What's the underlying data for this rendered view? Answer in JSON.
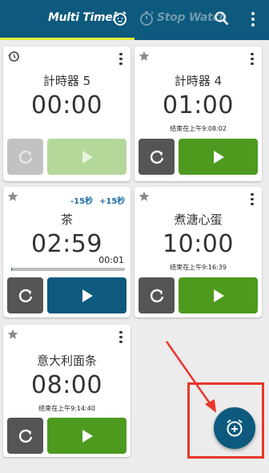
{
  "header": {
    "tab_multi_timer": "Multi Timer",
    "tab_stop_watch": "Stop Watch"
  },
  "colors": {
    "header_bg": "#0d5a7e",
    "tab_indicator": "#e6ee3a",
    "play_green": "#4d9a1f",
    "play_running": "#0d5a7e",
    "highlight_red": "#e8362a"
  },
  "timers": [
    {
      "title": "計時器 5",
      "time": "00:00",
      "end_info": "",
      "state": "disabled",
      "has_history_icon": true
    },
    {
      "title": "計時器 4",
      "time": "01:00",
      "end_info": "结束在上午9:08:02",
      "state": "ready"
    },
    {
      "title": "茶",
      "time": "02:59",
      "end_info": "",
      "state": "running",
      "adjust_minus": "-15秒",
      "adjust_plus": "+15秒",
      "elapsed": "00:01",
      "progress_pct": 1
    },
    {
      "title": "煮溏心蛋",
      "time": "10:00",
      "end_info": "结束在上午9:16:39",
      "state": "ready"
    },
    {
      "title": "意大利面条",
      "time": "08:00",
      "end_info": "结束在上午9:14:40",
      "state": "ready"
    }
  ],
  "icons": {
    "tab_multi": "alarm-clock-icon",
    "tab_stop": "stopwatch-icon",
    "search": "search-icon",
    "overflow": "more-vert-icon",
    "star": "star-icon",
    "reset": "reset-icon",
    "play": "play-icon",
    "fab": "add-alarm-icon"
  }
}
